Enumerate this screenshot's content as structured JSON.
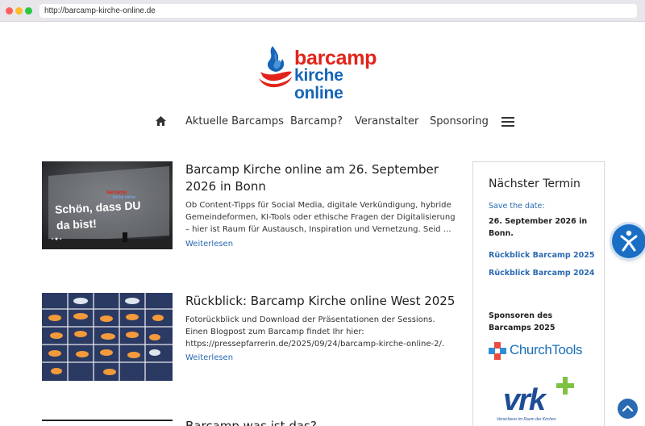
{
  "browser": {
    "url": "http://barcamp-kirche-online.de"
  },
  "logo": {
    "line1": "barcamp",
    "line2": "kirche online"
  },
  "nav": {
    "items": [
      "Aktuelle Barcamps",
      "Barcamp?",
      "Veranstalter",
      "Sponsoring"
    ]
  },
  "posts": [
    {
      "title": "Barcamp Kirche online am 26. September 2026 in Bonn",
      "excerpt": "Ob Content-Tipps für Social Media, digitale Verkündigung, hybride Gemeindeformen, KI-Tools oder ethische Fragen der Digitalisierung – hier ist Raum für Austausch, Inspiration und Vernetzung. Seid …",
      "more": "Weiterlesen",
      "image_text_1": "Schön, dass DU",
      "image_text_2": "da bist!"
    },
    {
      "title": "Rückblick: Barcamp Kirche online West 2025",
      "excerpt": "Fotorückblick und Download der Präsentationen der Sessions. Einen Blogpost zum Barcamp findet Ihr hier: https://pressepfarrerin.de/2025/09/24/barcamp-kirche-online-2/.",
      "more": "Weiterlesen"
    },
    {
      "title": "Barcamp was ist das?"
    }
  ],
  "sidebar": {
    "heading": "Nächster Termin",
    "save_the_date": "Save the date:",
    "date": "26. September 2026 in Bonn.",
    "links": [
      "Rückblick Barcamp 2025",
      "Rückblick Barcamp 2024"
    ],
    "sponsors_heading": "Sponsoren des Barcamps 2025",
    "sponsor1": "ChurchTools",
    "sponsor2": "vrk",
    "sponsor2_tagline": "Versicherer im Raum der Kirchen"
  },
  "colors": {
    "link": "#2a6ab3",
    "logo_red": "#e2231a",
    "logo_blue": "#1565b8"
  }
}
